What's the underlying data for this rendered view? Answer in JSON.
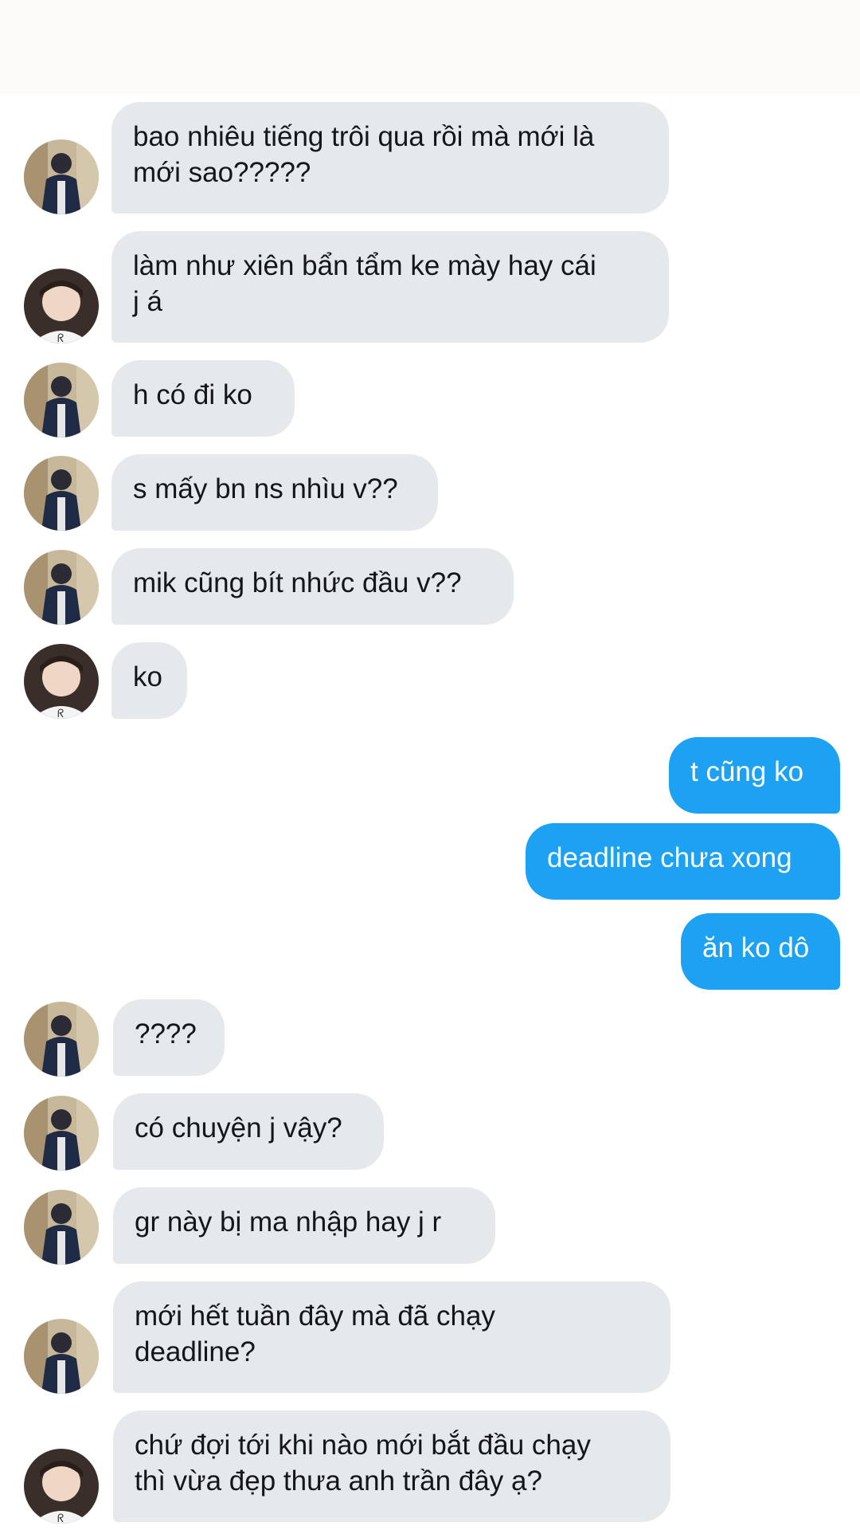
{
  "avatar_icons": {
    "friend_a": "avatar-boy-dark-jacket-icon",
    "friend_b": "avatar-kid-white-shirt-icon"
  },
  "colors": {
    "incoming_bubble": "#e6e9ec",
    "outgoing_bubble": "#1da1f2",
    "incoming_text": "#14171a",
    "outgoing_text": "#ffffff"
  },
  "messages": [
    {
      "sender": "friend_a",
      "direction": "incoming",
      "text": "bao nhiêu tiếng trôi qua rồi mà mới là\nmới sao?????"
    },
    {
      "sender": "friend_b",
      "direction": "incoming",
      "text": "làm như xiên bẩn tẩm ke mày hay cái\nj á"
    },
    {
      "sender": "friend_a",
      "direction": "incoming",
      "text": "h có đi ko"
    },
    {
      "sender": "friend_a",
      "direction": "incoming",
      "text": "s mấy bn ns nhìu v??"
    },
    {
      "sender": "friend_a",
      "direction": "incoming",
      "text": "mik cũng bít nhức đầu v??"
    },
    {
      "sender": "friend_b",
      "direction": "incoming",
      "text": "ko"
    },
    {
      "sender": "me",
      "direction": "outgoing",
      "text": "t cũng ko"
    },
    {
      "sender": "me",
      "direction": "outgoing",
      "text": "deadline chưa xong"
    },
    {
      "sender": "me",
      "direction": "outgoing",
      "text": "ăn ko dô"
    },
    {
      "sender": "friend_a",
      "direction": "incoming",
      "text": "????"
    },
    {
      "sender": "friend_a",
      "direction": "incoming",
      "text": "có chuyện j vậy?"
    },
    {
      "sender": "friend_a",
      "direction": "incoming",
      "text": "gr này bị ma nhập hay j r"
    },
    {
      "sender": "friend_a",
      "direction": "incoming",
      "text": "mới hết tuần đây mà đã chạy\ndeadline?"
    },
    {
      "sender": "friend_b",
      "direction": "incoming",
      "text": "chứ đợi tới khi nào mới bắt đầu chạy\nthì vừa đẹp thưa anh trần đây ạ?"
    }
  ]
}
